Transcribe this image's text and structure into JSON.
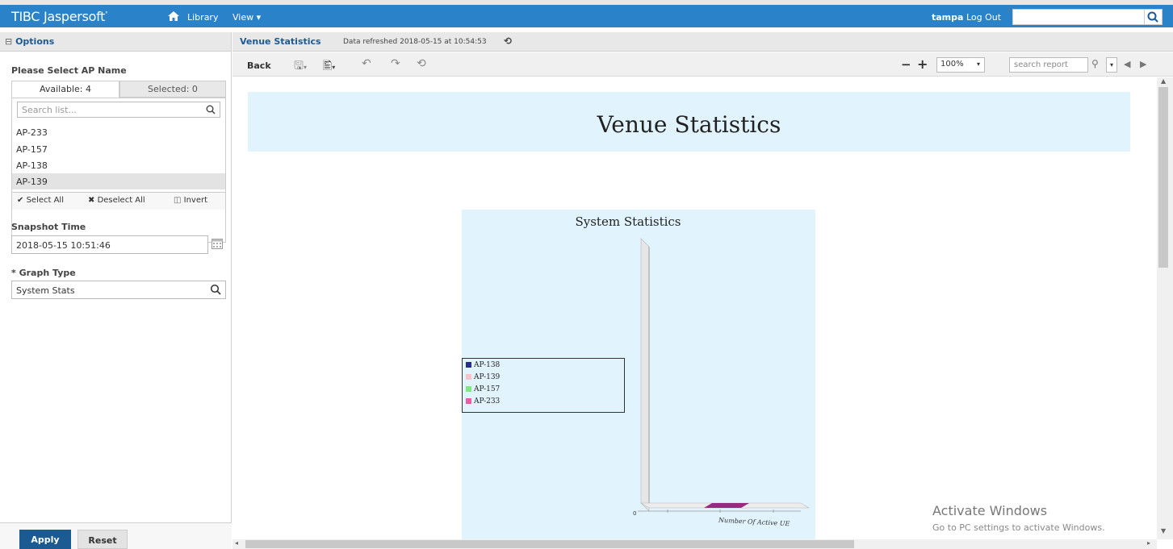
{
  "topbar": {
    "logo": "TIBC Jaspersoft",
    "library": "Library",
    "view": "View ▾",
    "user": "tampa",
    "logout": "Log Out"
  },
  "options": {
    "header": "Options",
    "ap_label": "Please Select AP Name",
    "tab_available": "Available: 4",
    "tab_selected": "Selected: 0",
    "search_placeholder": "Search list...",
    "items": [
      "AP-233",
      "AP-157",
      "AP-138",
      "AP-139"
    ],
    "select_all": "Select All",
    "deselect_all": "Deselect All",
    "invert": "Invert",
    "snapshot_label": "Snapshot Time",
    "snapshot_value": "2018-05-15 10:51:46",
    "graph_label": "* Graph Type",
    "graph_value": "System Stats",
    "apply": "Apply",
    "reset": "Reset"
  },
  "report": {
    "tab_title": "Venue Statistics",
    "refreshed": "Data refreshed 2018-05-15 at 10:54:53",
    "back": "Back",
    "zoom": "100%",
    "search_placeholder": "search report",
    "main_title": "Venue Statistics"
  },
  "chart_data": {
    "type": "bar",
    "title": "System Statistics",
    "categories": [
      "Number Of Active UE"
    ],
    "series": [
      {
        "name": "AP-138",
        "values": [
          0
        ],
        "color": "#2b2b8f"
      },
      {
        "name": "AP-139",
        "values": [
          0
        ],
        "color": "#f5c3c8"
      },
      {
        "name": "AP-157",
        "values": [
          0
        ],
        "color": "#7fe87f"
      },
      {
        "name": "AP-233",
        "values": [
          0
        ],
        "color": "#f05aa8"
      }
    ],
    "ytick_labels": [
      "0"
    ],
    "bar_color": "#9a2a7e"
  },
  "watermark": {
    "title": "Activate Windows",
    "subtitle": "Go to PC settings to activate Windows."
  }
}
